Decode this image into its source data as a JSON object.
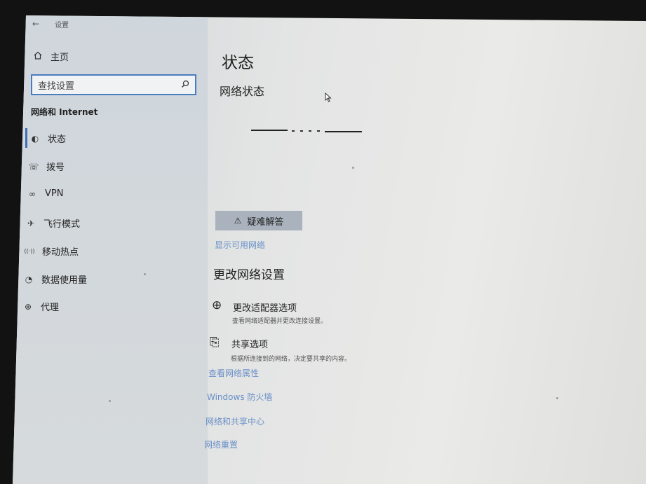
{
  "window": {
    "back_glyph": "←",
    "title": "设置"
  },
  "sidebar": {
    "home": {
      "icon": "home-icon",
      "label": "主页"
    },
    "search": {
      "placeholder": "查找设置",
      "icon": "search-icon"
    },
    "section_heading": "网络和 Internet",
    "items": [
      {
        "icon": "status-icon",
        "glyph": "◐",
        "label": "状态"
      },
      {
        "icon": "dialup-icon",
        "glyph": "☏",
        "label": "拨号"
      },
      {
        "icon": "vpn-icon",
        "glyph": "∞",
        "label": "VPN"
      },
      {
        "icon": "airplane-icon",
        "glyph": "✈",
        "label": "飞行模式"
      },
      {
        "icon": "hotspot-icon",
        "glyph": "((·))",
        "label": "移动热点"
      },
      {
        "icon": "data-usage-icon",
        "glyph": "◔",
        "label": "数据使用量"
      },
      {
        "icon": "proxy-icon",
        "glyph": "⊕",
        "label": "代理"
      }
    ],
    "active_index": 0
  },
  "main": {
    "title": "状态",
    "network_status_heading": "网络状态",
    "troubleshoot_button": {
      "icon": "warning-icon",
      "glyph": "⚠",
      "label": "疑难解答"
    },
    "show_networks_link": "显示可用网络",
    "change_settings_heading": "更改网络设置",
    "options": [
      {
        "icon": "adapter-icon",
        "glyph": "⊕",
        "title": "更改适配器选项",
        "desc": "查看网络适配器并更改连接设置。"
      },
      {
        "icon": "sharing-icon",
        "glyph": "⎘",
        "title": "共享选项",
        "desc": "根据所连接到的网络，决定要共享的内容。"
      }
    ],
    "links": [
      "查看网络属性",
      "Windows 防火墙",
      "网络和共享中心",
      "网络重置"
    ]
  },
  "colors": {
    "accent": "#3d6fb5",
    "link": "#6a90c8",
    "button_bg": "#a9b2bd"
  }
}
